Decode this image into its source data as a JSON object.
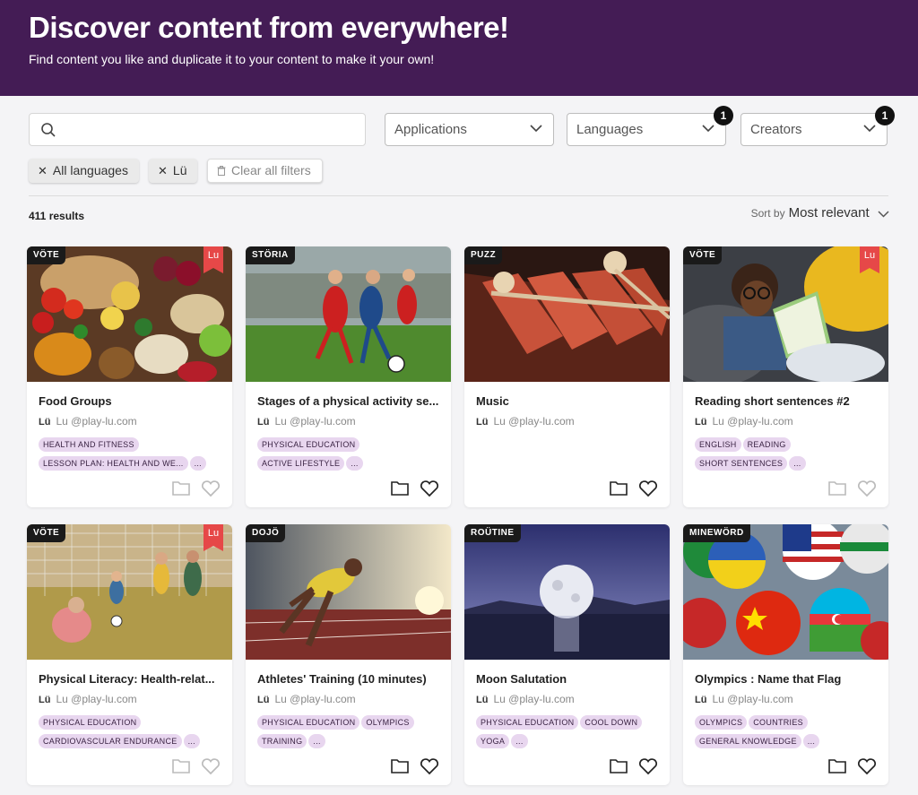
{
  "header": {
    "title": "Discover content from everywhere!",
    "subtitle": "Find content you like and duplicate it to your content to make it your own!"
  },
  "search": {
    "placeholder": "",
    "value": ""
  },
  "filters": {
    "applications": {
      "label": "Applications"
    },
    "languages": {
      "label": "Languages",
      "count": "1"
    },
    "creators": {
      "label": "Creators",
      "count": "1"
    }
  },
  "chips": {
    "all_languages": "All languages",
    "lu": "Lü",
    "clear": "Clear all filters"
  },
  "results": {
    "count_text": "411 results"
  },
  "sort": {
    "label": "Sort by",
    "value": "Most relevant"
  },
  "cards": [
    {
      "app": "VÖTE",
      "title": "Food Groups",
      "author": "Lu @play-lu.com",
      "tags": [
        "HEALTH AND FITNESS",
        "LESSON PLAN: HEALTH AND WE...",
        "..."
      ]
    },
    {
      "app": "STÖRIA",
      "title": "Stages of a physical activity se...",
      "author": "Lu @play-lu.com",
      "tags": [
        "PHYSICAL EDUCATION",
        "ACTIVE LIFESTYLE",
        "..."
      ]
    },
    {
      "app": "PUZZ",
      "title": "Music",
      "author": "Lu @play-lu.com",
      "tags": []
    },
    {
      "app": "VÖTE",
      "title": "Reading short sentences #2",
      "author": "Lu @play-lu.com",
      "tags": [
        "ENGLISH",
        "READING",
        "SHORT SENTENCES",
        "..."
      ]
    },
    {
      "app": "VÖTE",
      "title": "Physical Literacy: Health-relat...",
      "author": "Lu @play-lu.com",
      "tags": [
        "PHYSICAL EDUCATION",
        "CARDIOVASCULAR ENDURANCE",
        "..."
      ]
    },
    {
      "app": "DOJÖ",
      "title": "Athletes' Training (10 minutes)",
      "author": "Lu @play-lu.com",
      "tags": [
        "PHYSICAL EDUCATION",
        "OLYMPICS",
        "TRAINING",
        "..."
      ]
    },
    {
      "app": "ROÜTINE",
      "title": "Moon Salutation",
      "author": "Lu @play-lu.com",
      "tags": [
        "PHYSICAL EDUCATION",
        "COOL DOWN",
        "YOGA",
        "..."
      ]
    },
    {
      "app": "MINEWÖRD",
      "title": "Olympics : Name that Flag",
      "author": "Lu @play-lu.com",
      "tags": [
        "OLYMPICS",
        "COUNTRIES",
        "GENERAL KNOWLEDGE",
        "..."
      ]
    }
  ],
  "brand": {
    "lu_logo": "Lü",
    "ribbon": "Lu"
  }
}
